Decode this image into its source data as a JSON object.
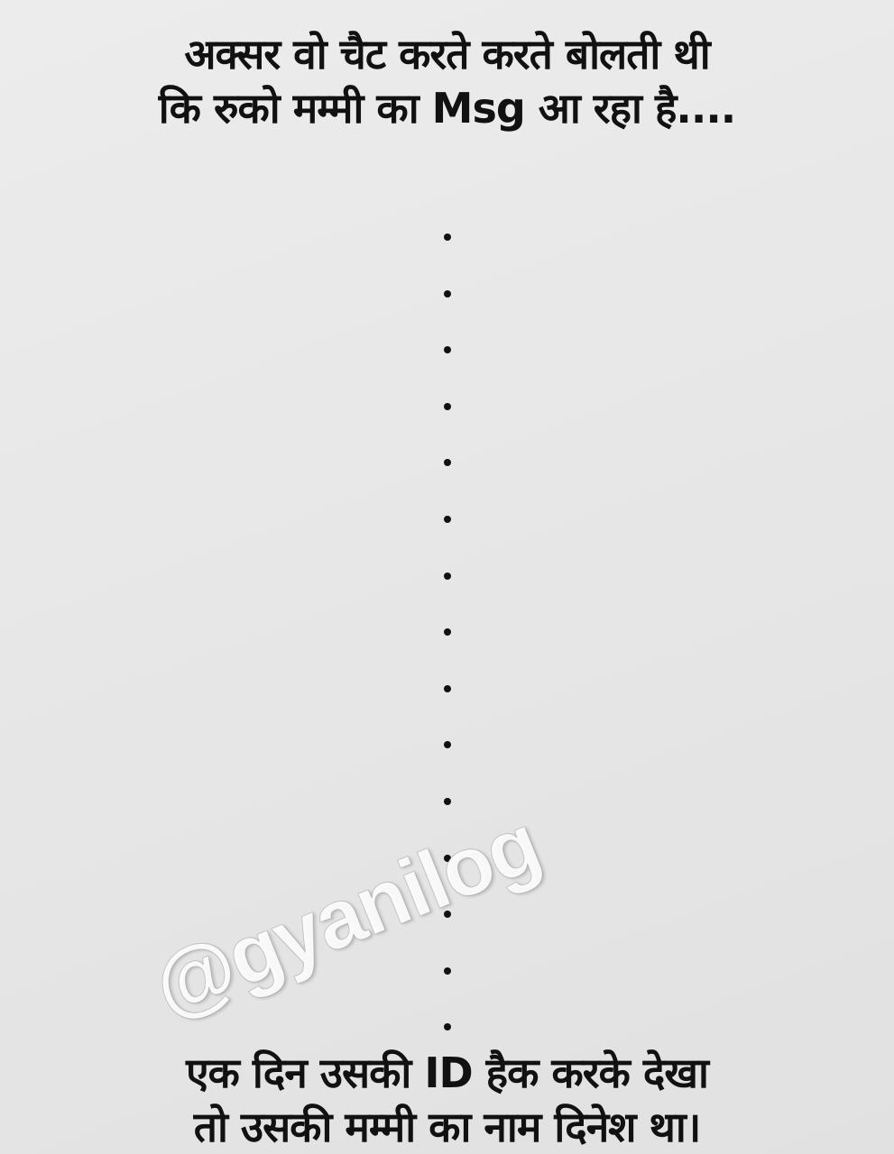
{
  "post": {
    "top_caption": {
      "line1": "अक्सर वो चैट करते करते बोलती थी",
      "line2": "कि रुको मम्मी का Msg आ रहा है...."
    },
    "bottom_caption": {
      "line1": "एक दिन उसकी ID हैक करके देखा",
      "line2": "तो उसकी मम्मी का नाम दिनेश था।"
    },
    "watermark": "@gyanilog"
  },
  "colors": {
    "text": "#111111",
    "background": "#e8e8e8",
    "watermark": "#ffffff"
  }
}
